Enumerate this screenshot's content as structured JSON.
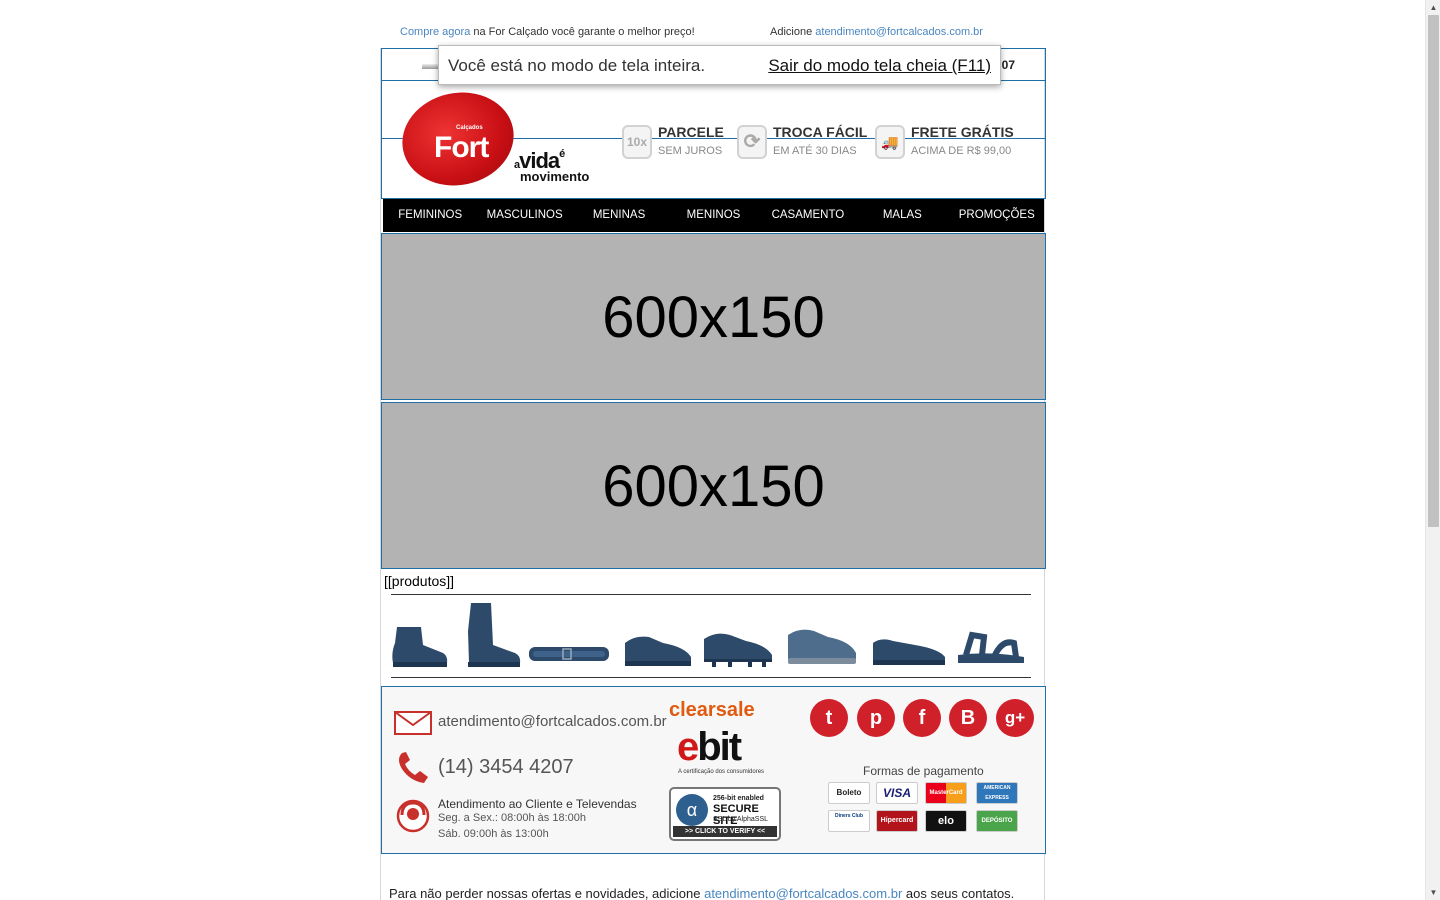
{
  "topbar": {
    "buy_link": "Compre agora",
    "buy_text": " na For Calçado você garante o melhor preço!",
    "add_text": "Adicione ",
    "add_email": "atendimento@fortcalcados.com.br"
  },
  "phone_bar": {
    "number_fragment": "07"
  },
  "header": {
    "logo": {
      "small": "Calçados",
      "brand": "Fort",
      "tag_prefix": "a",
      "tag_main": "vida",
      "tag_suffix": "é",
      "tag_line2": "movimento"
    },
    "features": [
      {
        "icon": "installments-icon",
        "icon_text": "10x",
        "title": "PARCELE",
        "subtitle": "SEM JUROS"
      },
      {
        "icon": "refresh-icon",
        "icon_text": "⟳",
        "title": "TROCA FÁCIL",
        "subtitle": "EM ATÉ 30 DIAS"
      },
      {
        "icon": "truck-icon",
        "icon_text": "🚚",
        "title": "FRETE GRÁTIS",
        "subtitle": "ACIMA DE R$ 99,00"
      }
    ]
  },
  "nav": [
    "FEMININOS",
    "MASCULINOS",
    "MENINAS",
    "MENINOS",
    "CASAMENTO",
    "MALAS",
    "PROMOÇÕES"
  ],
  "banners": [
    "600x150",
    "600x150"
  ],
  "products_placeholder": "[[produtos]]",
  "categories": [
    "ankle-boot-icon",
    "tall-boot-icon",
    "belt-icon",
    "oxford-shoe-icon",
    "cleat-icon",
    "sneaker-icon",
    "loafer-icon",
    "sandal-icon"
  ],
  "footer": {
    "email": "atendimento@fortcalcados.com.br",
    "phone": "(14) 3454 4207",
    "hours_title": "Atendimento ao Cliente e Televendas",
    "hours_weekday": "Seg. a Sex.: 08:00h às 18:00h",
    "hours_saturday": "Sáb. 09:00h às 13:00h",
    "clearsale": "clearsale",
    "ebit_e": "e",
    "ebit_rest": "bit",
    "ebit_sub": "A certificação dos consumidores",
    "secure": {
      "line1": "256-bit enabled",
      "line2": "SECURE SITE",
      "line3": "SSL by AlphaSSL",
      "verify": ">> CLICK TO VERIFY <<"
    },
    "social": [
      {
        "icon": "twitter-icon",
        "glyph": "t",
        "color": "#d0202a"
      },
      {
        "icon": "pinterest-icon",
        "glyph": "p",
        "color": "#d0202a"
      },
      {
        "icon": "facebook-icon",
        "glyph": "f",
        "color": "#d0202a"
      },
      {
        "icon": "blogger-icon",
        "glyph": "B",
        "color": "#d0202a"
      },
      {
        "icon": "google-plus-icon",
        "glyph": "g+",
        "color": "#d0202a"
      }
    ],
    "payments_title": "Formas de pagamento",
    "payments": [
      "Boleto",
      "VISA",
      "MasterCard",
      "AMERICAN EXPRESS",
      "Diners Club",
      "Hipercard",
      "elo",
      "DEPÓSITO"
    ]
  },
  "bottom": {
    "prefix": "Para não perder nossas ofertas e novidades, adicione ",
    "email": "atendimento@fortcalcados.com.br",
    "suffix": " aos seus contatos."
  },
  "fullscreen_notice": {
    "message": "Você está no modo de tela inteira.",
    "exit_label": "Sair do modo tela cheia (F11)"
  }
}
